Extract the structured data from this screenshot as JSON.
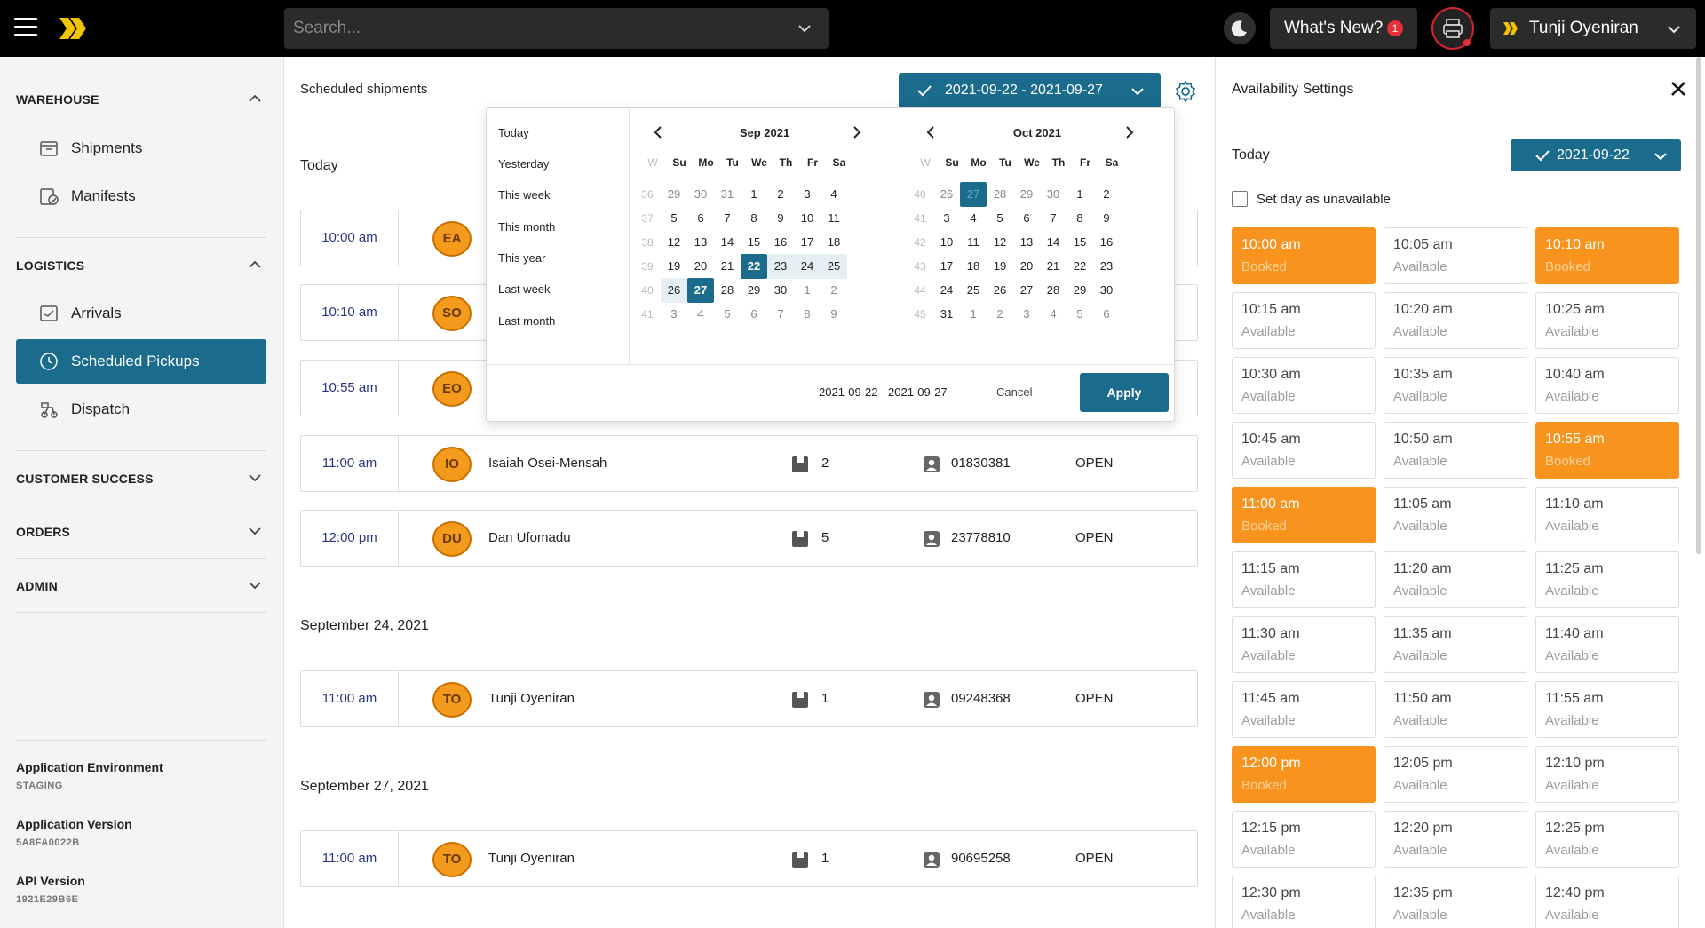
{
  "header": {
    "search_placeholder": "Search...",
    "whats_new_label": "What's New?",
    "whats_new_count": "1",
    "user_name": "Tunji Oyeniran"
  },
  "sidebar": {
    "sections": [
      {
        "title": "WAREHOUSE",
        "expanded": true,
        "items": [
          {
            "label": "Shipments",
            "icon": "box-icon"
          },
          {
            "label": "Manifests",
            "icon": "manifest-icon"
          }
        ]
      },
      {
        "title": "LOGISTICS",
        "expanded": true,
        "items": [
          {
            "label": "Arrivals",
            "icon": "arrivals-icon"
          },
          {
            "label": "Scheduled Pickups",
            "icon": "clock-icon",
            "active": true
          },
          {
            "label": "Dispatch",
            "icon": "dispatch-icon"
          }
        ]
      },
      {
        "title": "CUSTOMER SUCCESS",
        "expanded": false
      },
      {
        "title": "ORDERS",
        "expanded": false
      },
      {
        "title": "ADMIN",
        "expanded": false
      }
    ],
    "env": [
      {
        "label": "Application Environment",
        "value": "STAGING"
      },
      {
        "label": "Application Version",
        "value": "5A8FA0022B"
      },
      {
        "label": "API Version",
        "value": "1921E29B6E"
      }
    ]
  },
  "main": {
    "title": "Scheduled shipments",
    "date_range": "2021-09-22 - 2021-09-27",
    "groups": [
      {
        "heading": "Today",
        "rows": [
          {
            "time": "10:00 am",
            "initials": "EA"
          },
          {
            "time": "10:10 am",
            "initials": "SO"
          },
          {
            "time": "10:55 am",
            "initials": "EO"
          },
          {
            "time": "11:00 am",
            "initials": "IO",
            "name": "Isaiah Osei-Mensah",
            "count": "2",
            "tracking": "01830381",
            "status": "OPEN"
          },
          {
            "time": "12:00 pm",
            "initials": "DU",
            "name": "Dan Ufomadu",
            "count": "5",
            "tracking": "23778810",
            "status": "OPEN"
          }
        ]
      },
      {
        "heading": "September 24, 2021",
        "rows": [
          {
            "time": "11:00 am",
            "initials": "TO",
            "name": "Tunji Oyeniran",
            "count": "1",
            "tracking": "09248368",
            "status": "OPEN"
          }
        ]
      },
      {
        "heading": "September 27, 2021",
        "rows": [
          {
            "time": "11:00 am",
            "initials": "TO",
            "name": "Tunji Oyeniran",
            "count": "1",
            "tracking": "90695258",
            "status": "OPEN"
          }
        ]
      }
    ]
  },
  "datepicker": {
    "presets": [
      "Today",
      "Yesterday",
      "This week",
      "This month",
      "This year",
      "Last week",
      "Last month"
    ],
    "day_headers": [
      "W",
      "Su",
      "Mo",
      "Tu",
      "We",
      "Th",
      "Fr",
      "Sa"
    ],
    "months": [
      {
        "title": "Sep 2021",
        "weeks": [
          [
            "36",
            "29",
            "30",
            "31",
            "1",
            "2",
            "3",
            "4"
          ],
          [
            "37",
            "5",
            "6",
            "7",
            "8",
            "9",
            "10",
            "11"
          ],
          [
            "38",
            "12",
            "13",
            "14",
            "15",
            "16",
            "17",
            "18"
          ],
          [
            "39",
            "19",
            "20",
            "21",
            "22",
            "23",
            "24",
            "25"
          ],
          [
            "40",
            "26",
            "27",
            "28",
            "29",
            "30",
            "1",
            "2"
          ],
          [
            "41",
            "3",
            "4",
            "5",
            "6",
            "7",
            "8",
            "9"
          ]
        ]
      },
      {
        "title": "Oct 2021",
        "weeks": [
          [
            "40",
            "26",
            "27",
            "28",
            "29",
            "30",
            "1",
            "2"
          ],
          [
            "41",
            "3",
            "4",
            "5",
            "6",
            "7",
            "8",
            "9"
          ],
          [
            "42",
            "10",
            "11",
            "12",
            "13",
            "14",
            "15",
            "16"
          ],
          [
            "43",
            "17",
            "18",
            "19",
            "20",
            "21",
            "22",
            "23"
          ],
          [
            "44",
            "24",
            "25",
            "26",
            "27",
            "28",
            "29",
            "30"
          ],
          [
            "45",
            "31",
            "1",
            "2",
            "3",
            "4",
            "5",
            "6"
          ]
        ]
      }
    ],
    "footer_range": "2021-09-22 - 2021-09-27",
    "cancel_label": "Cancel",
    "apply_label": "Apply"
  },
  "availability": {
    "title": "Availability Settings",
    "day_label": "Today",
    "selected_date": "2021-09-22",
    "unavailable_label": "Set day as unavailable",
    "slots": [
      {
        "time": "10:00 am",
        "status": "Booked"
      },
      {
        "time": "10:05 am",
        "status": "Available"
      },
      {
        "time": "10:10 am",
        "status": "Booked"
      },
      {
        "time": "10:15 am",
        "status": "Available"
      },
      {
        "time": "10:20 am",
        "status": "Available"
      },
      {
        "time": "10:25 am",
        "status": "Available"
      },
      {
        "time": "10:30 am",
        "status": "Available"
      },
      {
        "time": "10:35 am",
        "status": "Available"
      },
      {
        "time": "10:40 am",
        "status": "Available"
      },
      {
        "time": "10:45 am",
        "status": "Available"
      },
      {
        "time": "10:50 am",
        "status": "Available"
      },
      {
        "time": "10:55 am",
        "status": "Booked"
      },
      {
        "time": "11:00 am",
        "status": "Booked"
      },
      {
        "time": "11:05 am",
        "status": "Available"
      },
      {
        "time": "11:10 am",
        "status": "Available"
      },
      {
        "time": "11:15 am",
        "status": "Available"
      },
      {
        "time": "11:20 am",
        "status": "Available"
      },
      {
        "time": "11:25 am",
        "status": "Available"
      },
      {
        "time": "11:30 am",
        "status": "Available"
      },
      {
        "time": "11:35 am",
        "status": "Available"
      },
      {
        "time": "11:40 am",
        "status": "Available"
      },
      {
        "time": "11:45 am",
        "status": "Available"
      },
      {
        "time": "11:50 am",
        "status": "Available"
      },
      {
        "time": "11:55 am",
        "status": "Available"
      },
      {
        "time": "12:00 pm",
        "status": "Booked"
      },
      {
        "time": "12:05 pm",
        "status": "Available"
      },
      {
        "time": "12:10 pm",
        "status": "Available"
      },
      {
        "time": "12:15 pm",
        "status": "Available"
      },
      {
        "time": "12:20 pm",
        "status": "Available"
      },
      {
        "time": "12:25 pm",
        "status": "Available"
      },
      {
        "time": "12:30 pm",
        "status": "Available"
      },
      {
        "time": "12:35 pm",
        "status": "Available"
      },
      {
        "time": "12:40 pm",
        "status": "Available"
      }
    ]
  },
  "colors": {
    "accent": "#1a6b8c",
    "booked": "#f8941d",
    "avatar": "#f49a1c",
    "alert": "#e5303a"
  }
}
